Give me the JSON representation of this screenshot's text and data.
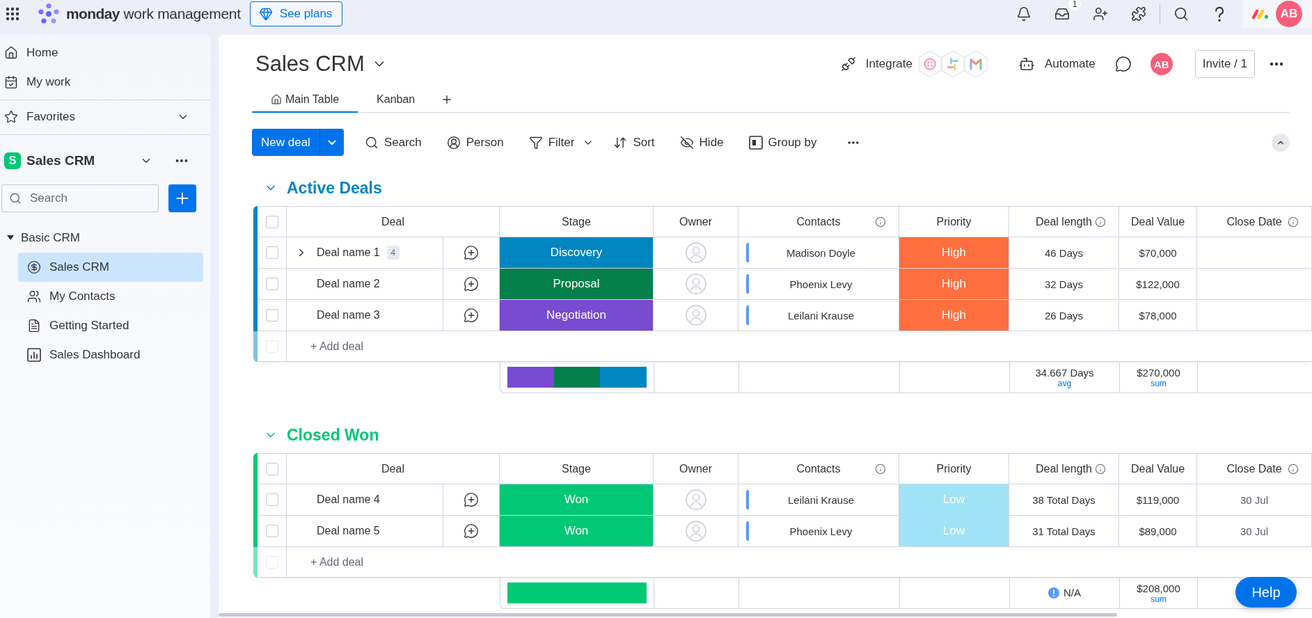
{
  "top_bar": {
    "brand": "**monday** work management",
    "plans_button": "See plans",
    "inbox_badge": "1",
    "avatar": "AB"
  },
  "sidebar": {
    "nav": [
      {
        "kind": "home",
        "label": "Home"
      },
      {
        "kind": "work",
        "label": "My work"
      }
    ],
    "favorites": {
      "label": "Favorites",
      "expanded": false
    },
    "workspace": {
      "badge": "S",
      "name": "Sales CRM"
    },
    "search": {
      "placeholder": "Search"
    },
    "folders": [
      {
        "label": "Basic CRM",
        "expanded": true,
        "children": [
          {
            "kind": "board",
            "label": "Sales CRM",
            "selected": true
          },
          {
            "kind": "contacts",
            "label": "My Contacts",
            "selected": false
          },
          {
            "kind": "doc",
            "label": "Getting Started",
            "selected": false
          },
          {
            "kind": "dashboard",
            "label": "Sales Dashboard",
            "selected": false
          }
        ]
      }
    ]
  },
  "board": {
    "title": "Sales CRM",
    "integrate": "Integrate",
    "automate": "Automate",
    "avatar": "AB",
    "invite": "Invite / 1",
    "views": [
      {
        "kind": "home",
        "label": "Main Table",
        "selected": true
      },
      {
        "kind": "plain",
        "label": "Kanban",
        "selected": false
      }
    ],
    "toolbar": {
      "new_button": "New deal",
      "tools": [
        {
          "kind": "search",
          "label": "Search"
        },
        {
          "kind": "person",
          "label": "Person"
        },
        {
          "kind": "filter",
          "label": "Filter"
        },
        {
          "kind": "sort",
          "label": "Sort"
        },
        {
          "kind": "hide",
          "label": "Hide"
        },
        {
          "kind": "group",
          "label": "Group by"
        }
      ]
    }
  },
  "groups": [
    {
      "title": "Active Deals",
      "color": "#0086c0",
      "expanded": true,
      "all_checked": false,
      "columns": [
        {
          "title": "Deal",
          "info": false
        },
        {
          "title": "Stage",
          "info": false
        },
        {
          "title": "Owner",
          "info": false
        },
        {
          "title": "Contacts",
          "info": true
        },
        {
          "title": "Priority",
          "info": false
        },
        {
          "title": "Deal length",
          "info": true
        },
        {
          "title": "Deal Value",
          "info": false
        },
        {
          "title": "Close Date",
          "info": true
        }
      ],
      "rows": [
        {
          "checked": false,
          "name": "Deal name 1",
          "subitems": "4",
          "stage": {
            "label": "Discovery",
            "color": "#0086c0"
          },
          "contact": "Madison Doyle",
          "priority": {
            "label": "High",
            "color": "#ff6f3f"
          },
          "deal_length": "46 Days",
          "deal_value": "$70,000"
        },
        {
          "checked": false,
          "name": "Deal name 2",
          "stage": {
            "label": "Proposal",
            "color": "#037f4c"
          },
          "contact": "Phoenix Levy",
          "priority": {
            "label": "High",
            "color": "#ff6f3f"
          },
          "deal_length": "32 Days",
          "deal_value": "$122,000"
        },
        {
          "checked": false,
          "name": "Deal name 3",
          "stage": {
            "label": "Negotiation",
            "color": "#784bd1"
          },
          "contact": "Leilani Krause",
          "priority": {
            "label": "High",
            "color": "#ff6f3f"
          },
          "deal_length": "26 Days",
          "deal_value": "$78,000"
        }
      ],
      "add_item": {
        "placeholder": "+ Add deal"
      },
      "summary": {
        "stage": [
          {
            "color": "#784bd1"
          },
          {
            "color": "#037f4c"
          },
          {
            "color": "#0086c0"
          }
        ],
        "deal_length": {
          "value": "34.667 Days",
          "function": "avg",
          "warning": false
        },
        "deal_value": {
          "value": "$270,000",
          "function": "sum"
        }
      }
    },
    {
      "title": "Closed Won",
      "color": "#00c875",
      "expanded": true,
      "all_checked": false,
      "columns": [
        {
          "title": "Deal",
          "info": false
        },
        {
          "title": "Stage",
          "info": false
        },
        {
          "title": "Owner",
          "info": false
        },
        {
          "title": "Contacts",
          "info": true
        },
        {
          "title": "Priority",
          "info": false
        },
        {
          "title": "Deal length",
          "info": true
        },
        {
          "title": "Deal Value",
          "info": false
        },
        {
          "title": "Close Date",
          "info": true
        }
      ],
      "rows": [
        {
          "checked": false,
          "name": "Deal name 4",
          "stage": {
            "label": "Won",
            "color": "#00c875"
          },
          "contact": "Leilani Krause",
          "priority": {
            "label": "Low",
            "color": "#a1e3f6"
          },
          "deal_length": "38 Total Days",
          "deal_value": "$119,000",
          "close_date": "30 Jul"
        },
        {
          "checked": false,
          "name": "Deal name 5",
          "stage": {
            "label": "Won",
            "color": "#00c875"
          },
          "contact": "Phoenix Levy",
          "priority": {
            "label": "Low",
            "color": "#a1e3f6"
          },
          "deal_length": "31 Total Days",
          "deal_value": "$89,000",
          "close_date": "30 Jul"
        }
      ],
      "add_item": {
        "placeholder": "+ Add deal"
      },
      "summary": {
        "stage": [
          {
            "color": "#00c875"
          }
        ],
        "deal_length": {
          "value": "N/A",
          "warning": true
        },
        "deal_value": {
          "value": "$208,000",
          "function": "sum"
        }
      }
    }
  ],
  "help_button": "Help"
}
